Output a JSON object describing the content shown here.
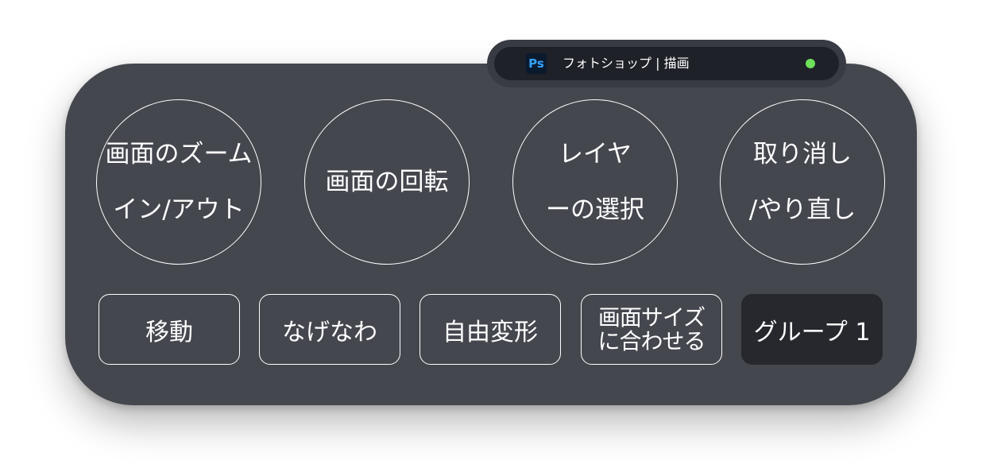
{
  "titlebar": {
    "app_icon": "ps-icon",
    "app_icon_text": "Ps",
    "title": "フォトショップ | 描画",
    "status_color": "#6ee05a"
  },
  "circle_buttons": [
    {
      "line1": "画面のズーム",
      "line2": "イン/アウト"
    },
    {
      "line1": "画面の回転"
    },
    {
      "line1": "レイヤ",
      "line2": "ーの選択"
    },
    {
      "line1": "取り消し",
      "line2": "/やり直し"
    }
  ],
  "rect_buttons": [
    {
      "label": "移動"
    },
    {
      "label": "なげなわ"
    },
    {
      "label": "自由変形"
    },
    {
      "line1": "画面サイズ",
      "line2": "に合わせる"
    },
    {
      "label": "グループ 1"
    }
  ],
  "colors": {
    "panel": "#45474f",
    "titlebar": "#1f2128",
    "selected_button": "#26282e",
    "photoshop_blue": "#32a2ff"
  }
}
